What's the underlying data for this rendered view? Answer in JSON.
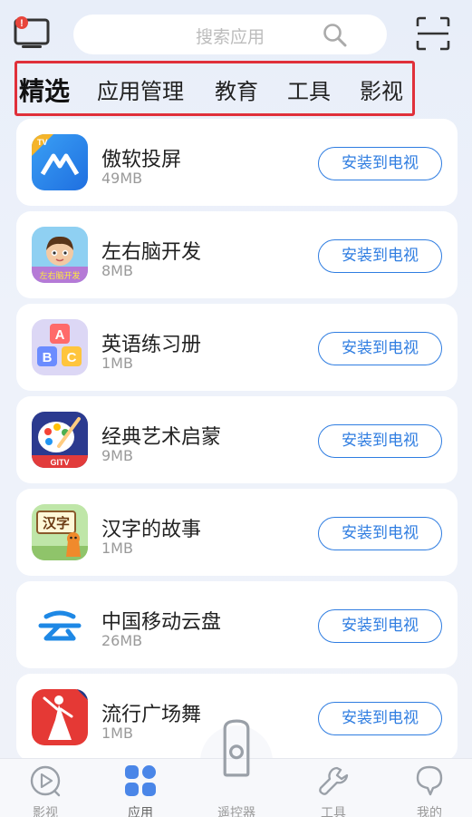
{
  "header": {
    "search_placeholder": "搜索应用",
    "notification_badge": "!"
  },
  "tabs": [
    {
      "label": "精选",
      "active": true
    },
    {
      "label": "应用管理",
      "active": false
    },
    {
      "label": "教育",
      "active": false
    },
    {
      "label": "工具",
      "active": false
    },
    {
      "label": "影视",
      "active": false
    }
  ],
  "apps": [
    {
      "name": "傲软投屏",
      "size": "49MB",
      "button": "安装到电视",
      "icon": "aoruan-cast-icon"
    },
    {
      "name": "左右脑开发",
      "size": "8MB",
      "button": "安装到电视",
      "icon": "brain-dev-icon"
    },
    {
      "name": "英语练习册",
      "size": "1MB",
      "button": "安装到电视",
      "icon": "abc-blocks-icon"
    },
    {
      "name": "经典艺术启蒙",
      "size": "9MB",
      "button": "安装到电视",
      "icon": "art-palette-icon"
    },
    {
      "name": "汉字的故事",
      "size": "1MB",
      "button": "安装到电视",
      "icon": "chinese-characters-icon"
    },
    {
      "name": "中国移动云盘",
      "size": "26MB",
      "button": "安装到电视",
      "icon": "cloud-disk-icon"
    },
    {
      "name": "流行广场舞",
      "size": "1MB",
      "button": "安装到电视",
      "icon": "square-dance-icon"
    }
  ],
  "icon_texts": {
    "app0_badge": "TV",
    "app1_caption": "左右脑开发",
    "app2_letters": [
      "A",
      "B",
      "C"
    ],
    "app3_caption": "GITV",
    "app4_characters": "汉字"
  },
  "bottom_nav": [
    {
      "label": "影视",
      "icon": "video-play-icon",
      "active": false
    },
    {
      "label": "应用",
      "icon": "apps-grid-icon",
      "active": true
    },
    {
      "label": "遥控器",
      "icon": "remote-control-icon",
      "active": false
    },
    {
      "label": "工具",
      "icon": "wrench-icon",
      "active": false
    },
    {
      "label": "我的",
      "icon": "profile-icon",
      "active": false
    }
  ],
  "colors": {
    "accent": "#2f7de1",
    "tab_highlight_border": "#e0303a",
    "badge": "#e8453c",
    "active_nav": "#4a86e8"
  }
}
